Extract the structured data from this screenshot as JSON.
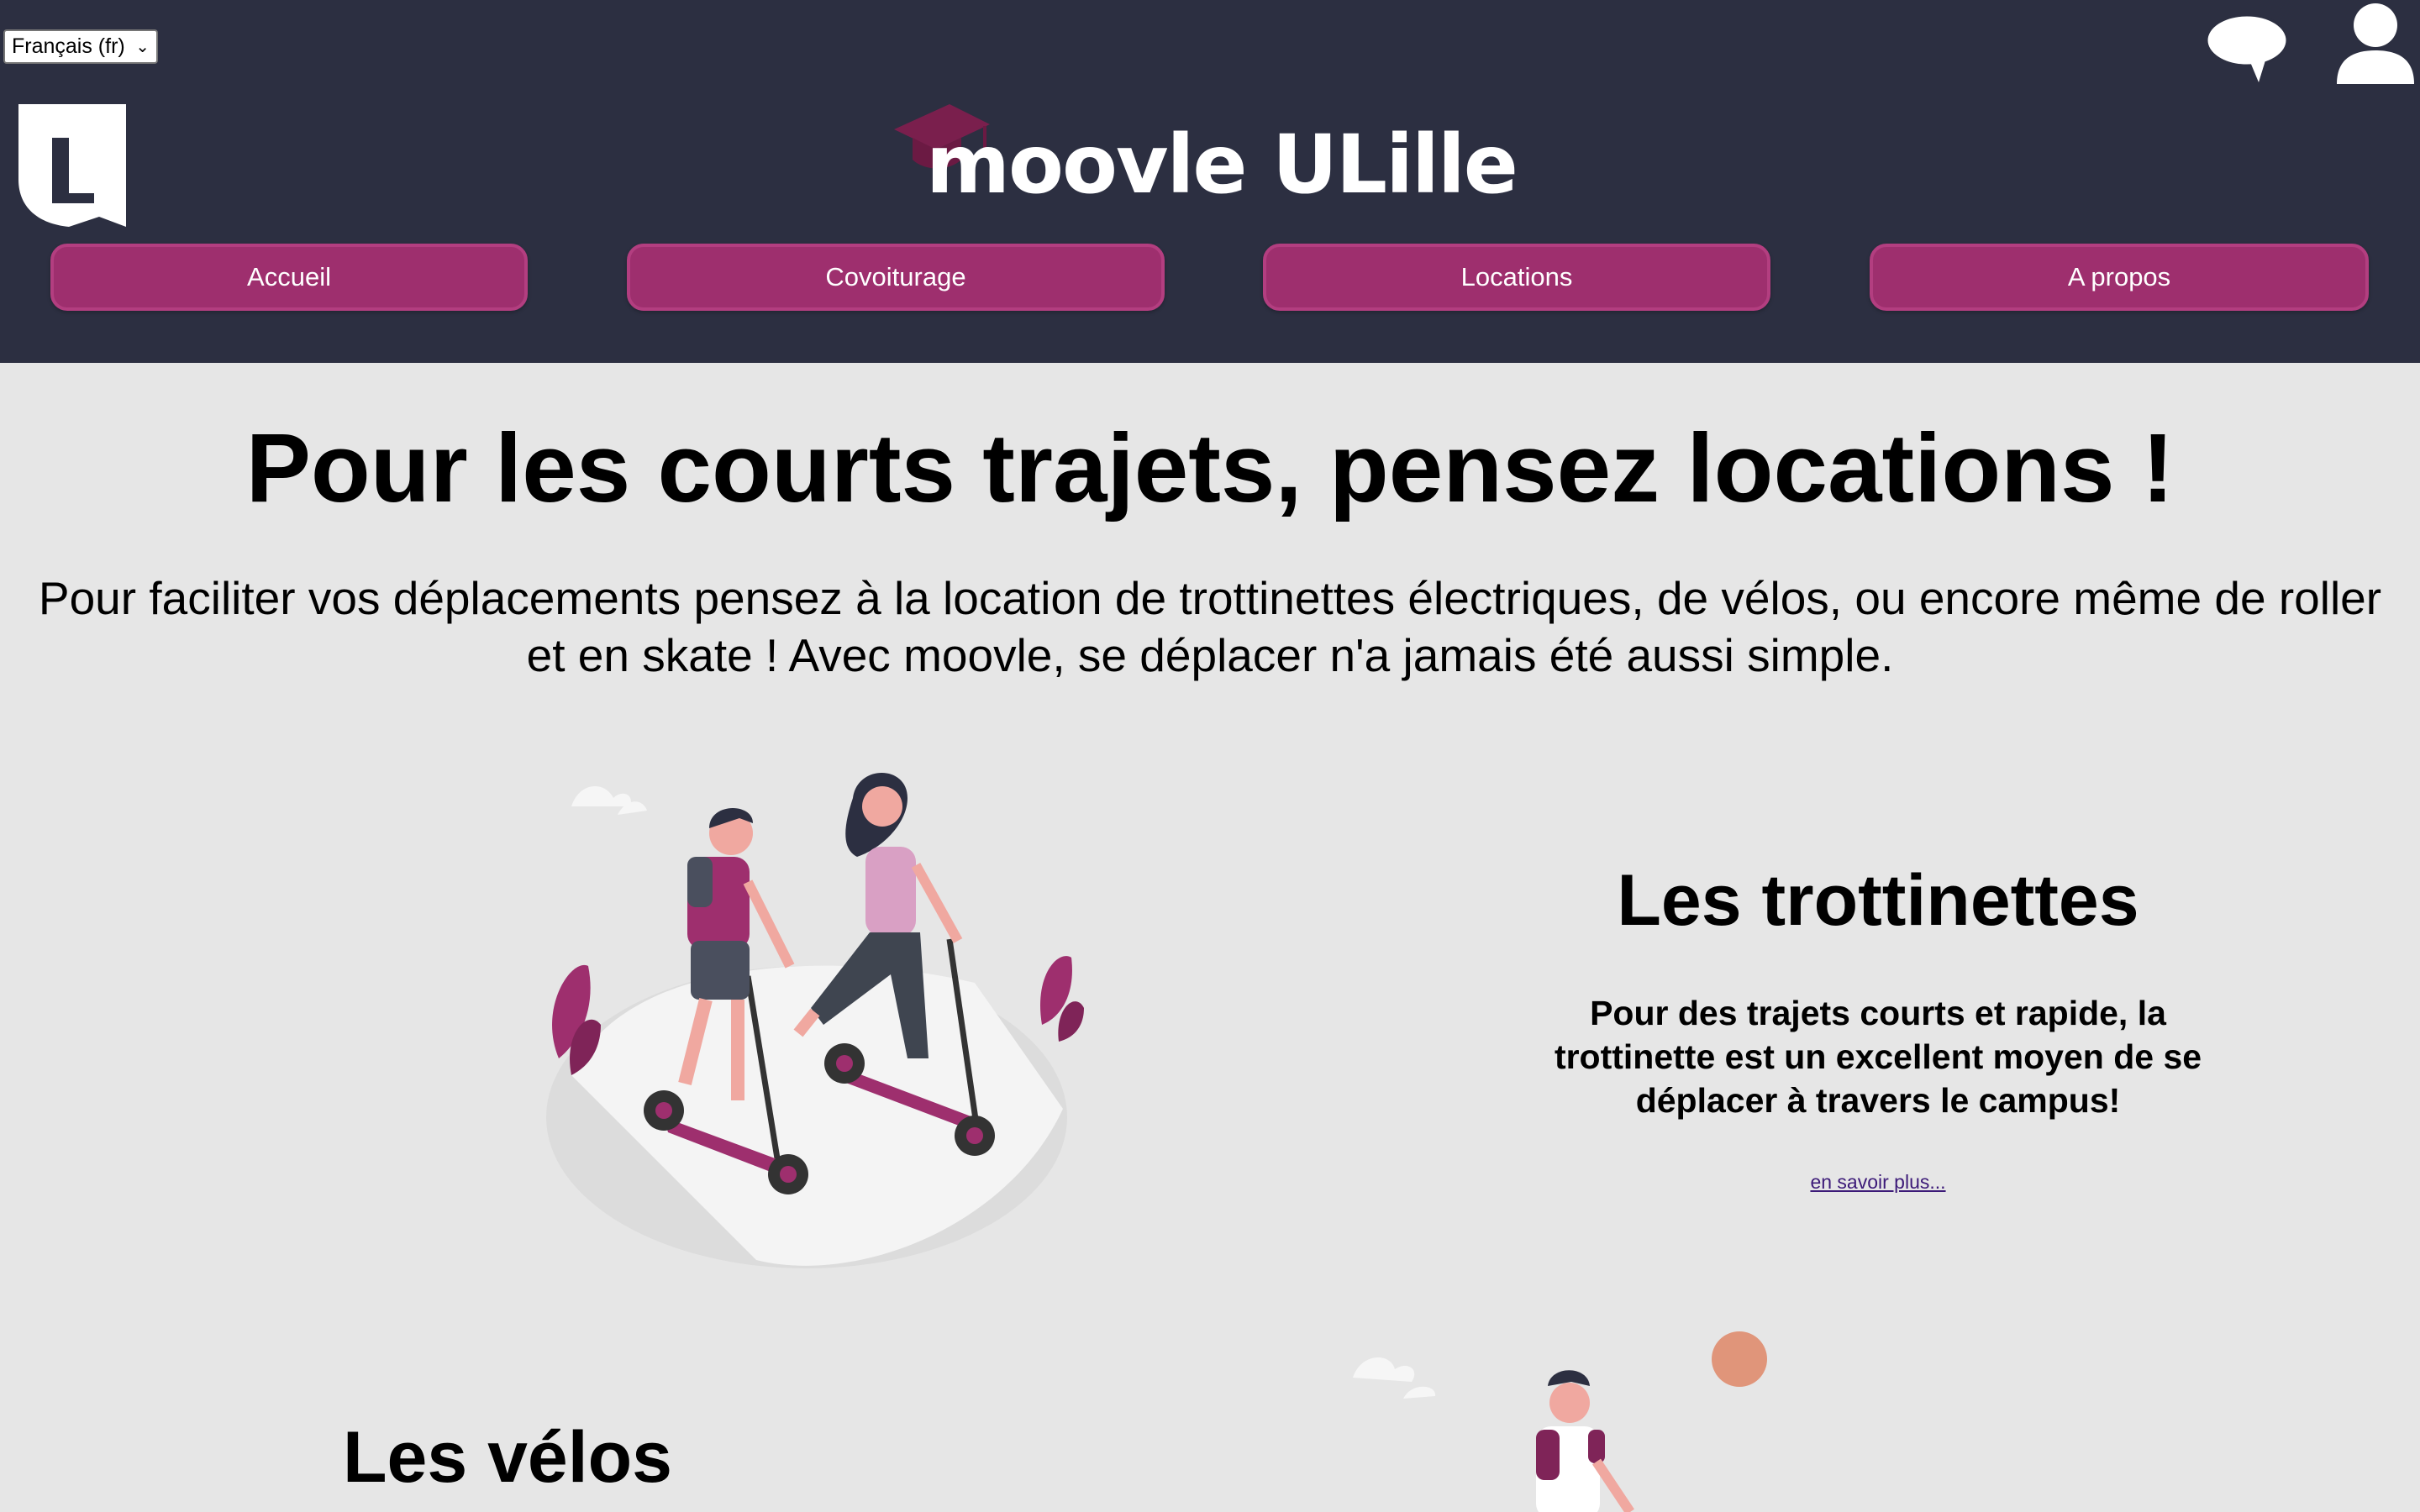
{
  "header": {
    "language_select": {
      "value": "Français (fr)"
    },
    "brand": "moovle ULille",
    "icons": {
      "chat": "chat-bubble-icon",
      "user": "user-icon",
      "university_logo": "ulille-logo"
    },
    "nav": [
      {
        "label": "Accueil"
      },
      {
        "label": "Covoiturage"
      },
      {
        "label": "Locations"
      },
      {
        "label": "A propos"
      }
    ]
  },
  "main": {
    "title": "Pour les courts trajets, pensez locations !",
    "intro": "Pour faciliter vos déplacements pensez à la location de trottinettes électriques, de vélos, ou encore même de roller et en skate ! Avec moovle, se déplacer n'a jamais été aussi simple.",
    "sections": [
      {
        "title": "Les trottinettes",
        "text": "Pour des trajets courts et rapide, la trottinette est un excellent moyen de se déplacer à travers le campus!",
        "link": "en savoir plus..."
      },
      {
        "title": "Les vélos"
      }
    ]
  },
  "colors": {
    "header_bg": "#2c2f41",
    "page_bg": "#e6e6e6",
    "accent": "#9e2f6e",
    "link": "#3c1a78"
  }
}
